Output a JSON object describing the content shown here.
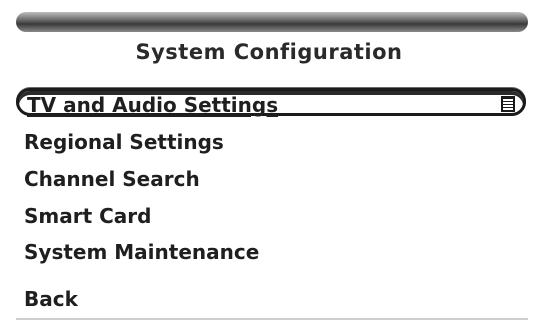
{
  "screen": {
    "title": "System Configuration"
  },
  "menu": {
    "items": [
      {
        "label": "TV and Audio Settings",
        "selected": true
      },
      {
        "label": "Regional Settings",
        "selected": false
      },
      {
        "label": "Channel Search",
        "selected": false
      },
      {
        "label": "Smart Card",
        "selected": false
      },
      {
        "label": "System Maintenance",
        "selected": false
      },
      {
        "label": "Back",
        "selected": false
      }
    ],
    "selected_icon": "submenu-list-icon"
  }
}
